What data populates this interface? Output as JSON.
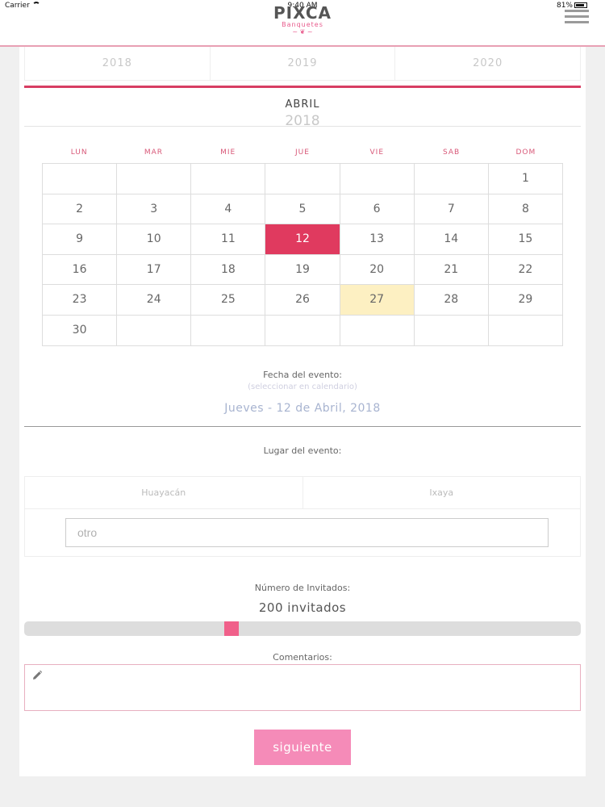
{
  "status_bar": {
    "carrier": "Carrier",
    "time": "9:40 AM",
    "battery": "81%"
  },
  "header": {
    "logo_text": "PIXCA",
    "logo_sub": "Banquetes",
    "logo_ornament": "~ ❦ ~",
    "menu_icon": "hamburger-icon"
  },
  "years": [
    "2018",
    "2019",
    "2020"
  ],
  "calendar": {
    "month": "ABRIL",
    "year": "2018",
    "weekdays": [
      "LUN",
      "MAR",
      "MIE",
      "JUE",
      "VIE",
      "SAB",
      "DOM"
    ],
    "days": [
      "",
      "",
      "",
      "",
      "",
      "",
      "1",
      "2",
      "3",
      "4",
      "5",
      "6",
      "7",
      "8",
      "9",
      "10",
      "11",
      "12",
      "13",
      "14",
      "15",
      "16",
      "17",
      "18",
      "19",
      "20",
      "21",
      "22",
      "23",
      "24",
      "25",
      "26",
      "27",
      "28",
      "29",
      "30",
      "",
      "",
      "",
      "",
      "",
      ""
    ],
    "selected_day": "12",
    "today_day": "27",
    "selected_color": "#e03a5f",
    "today_color": "#fdf0c2"
  },
  "event_date": {
    "label": "Fecha del evento:",
    "hint": "(seleccionar en calendario)",
    "value": "Jueves - 12 de Abril, 2018"
  },
  "event_place": {
    "label": "Lugar del evento:",
    "options": [
      "Huayacán",
      "Ixaya"
    ],
    "other_placeholder": "otro"
  },
  "guests": {
    "label": "Número de Invitados:",
    "value_text": "200 invitados",
    "slider_fraction": 0.36
  },
  "comments": {
    "label": "Comentarios:",
    "icon": "pencil-icon"
  },
  "next_button": {
    "label": "siguiente",
    "color": "#f58bb8"
  },
  "accent_color": "#d83e63"
}
